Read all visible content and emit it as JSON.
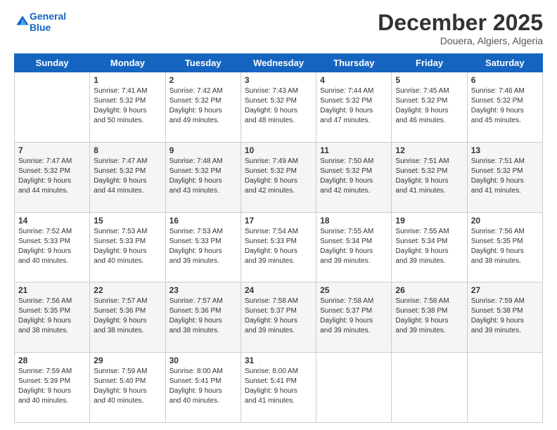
{
  "logo": {
    "line1": "General",
    "line2": "Blue"
  },
  "title": "December 2025",
  "location": "Douera, Algiers, Algeria",
  "days_of_week": [
    "Sunday",
    "Monday",
    "Tuesday",
    "Wednesday",
    "Thursday",
    "Friday",
    "Saturday"
  ],
  "weeks": [
    [
      {
        "num": "",
        "info": ""
      },
      {
        "num": "1",
        "info": "Sunrise: 7:41 AM\nSunset: 5:32 PM\nDaylight: 9 hours\nand 50 minutes."
      },
      {
        "num": "2",
        "info": "Sunrise: 7:42 AM\nSunset: 5:32 PM\nDaylight: 9 hours\nand 49 minutes."
      },
      {
        "num": "3",
        "info": "Sunrise: 7:43 AM\nSunset: 5:32 PM\nDaylight: 9 hours\nand 48 minutes."
      },
      {
        "num": "4",
        "info": "Sunrise: 7:44 AM\nSunset: 5:32 PM\nDaylight: 9 hours\nand 47 minutes."
      },
      {
        "num": "5",
        "info": "Sunrise: 7:45 AM\nSunset: 5:32 PM\nDaylight: 9 hours\nand 46 minutes."
      },
      {
        "num": "6",
        "info": "Sunrise: 7:46 AM\nSunset: 5:32 PM\nDaylight: 9 hours\nand 45 minutes."
      }
    ],
    [
      {
        "num": "7",
        "info": "Sunrise: 7:47 AM\nSunset: 5:32 PM\nDaylight: 9 hours\nand 44 minutes."
      },
      {
        "num": "8",
        "info": "Sunrise: 7:47 AM\nSunset: 5:32 PM\nDaylight: 9 hours\nand 44 minutes."
      },
      {
        "num": "9",
        "info": "Sunrise: 7:48 AM\nSunset: 5:32 PM\nDaylight: 9 hours\nand 43 minutes."
      },
      {
        "num": "10",
        "info": "Sunrise: 7:49 AM\nSunset: 5:32 PM\nDaylight: 9 hours\nand 42 minutes."
      },
      {
        "num": "11",
        "info": "Sunrise: 7:50 AM\nSunset: 5:32 PM\nDaylight: 9 hours\nand 42 minutes."
      },
      {
        "num": "12",
        "info": "Sunrise: 7:51 AM\nSunset: 5:32 PM\nDaylight: 9 hours\nand 41 minutes."
      },
      {
        "num": "13",
        "info": "Sunrise: 7:51 AM\nSunset: 5:32 PM\nDaylight: 9 hours\nand 41 minutes."
      }
    ],
    [
      {
        "num": "14",
        "info": "Sunrise: 7:52 AM\nSunset: 5:33 PM\nDaylight: 9 hours\nand 40 minutes."
      },
      {
        "num": "15",
        "info": "Sunrise: 7:53 AM\nSunset: 5:33 PM\nDaylight: 9 hours\nand 40 minutes."
      },
      {
        "num": "16",
        "info": "Sunrise: 7:53 AM\nSunset: 5:33 PM\nDaylight: 9 hours\nand 39 minutes."
      },
      {
        "num": "17",
        "info": "Sunrise: 7:54 AM\nSunset: 5:33 PM\nDaylight: 9 hours\nand 39 minutes."
      },
      {
        "num": "18",
        "info": "Sunrise: 7:55 AM\nSunset: 5:34 PM\nDaylight: 9 hours\nand 39 minutes."
      },
      {
        "num": "19",
        "info": "Sunrise: 7:55 AM\nSunset: 5:34 PM\nDaylight: 9 hours\nand 39 minutes."
      },
      {
        "num": "20",
        "info": "Sunrise: 7:56 AM\nSunset: 5:35 PM\nDaylight: 9 hours\nand 38 minutes."
      }
    ],
    [
      {
        "num": "21",
        "info": "Sunrise: 7:56 AM\nSunset: 5:35 PM\nDaylight: 9 hours\nand 38 minutes."
      },
      {
        "num": "22",
        "info": "Sunrise: 7:57 AM\nSunset: 5:36 PM\nDaylight: 9 hours\nand 38 minutes."
      },
      {
        "num": "23",
        "info": "Sunrise: 7:57 AM\nSunset: 5:36 PM\nDaylight: 9 hours\nand 38 minutes."
      },
      {
        "num": "24",
        "info": "Sunrise: 7:58 AM\nSunset: 5:37 PM\nDaylight: 9 hours\nand 39 minutes."
      },
      {
        "num": "25",
        "info": "Sunrise: 7:58 AM\nSunset: 5:37 PM\nDaylight: 9 hours\nand 39 minutes."
      },
      {
        "num": "26",
        "info": "Sunrise: 7:58 AM\nSunset: 5:38 PM\nDaylight: 9 hours\nand 39 minutes."
      },
      {
        "num": "27",
        "info": "Sunrise: 7:59 AM\nSunset: 5:38 PM\nDaylight: 9 hours\nand 39 minutes."
      }
    ],
    [
      {
        "num": "28",
        "info": "Sunrise: 7:59 AM\nSunset: 5:39 PM\nDaylight: 9 hours\nand 40 minutes."
      },
      {
        "num": "29",
        "info": "Sunrise: 7:59 AM\nSunset: 5:40 PM\nDaylight: 9 hours\nand 40 minutes."
      },
      {
        "num": "30",
        "info": "Sunrise: 8:00 AM\nSunset: 5:41 PM\nDaylight: 9 hours\nand 40 minutes."
      },
      {
        "num": "31",
        "info": "Sunrise: 8:00 AM\nSunset: 5:41 PM\nDaylight: 9 hours\nand 41 minutes."
      },
      {
        "num": "",
        "info": ""
      },
      {
        "num": "",
        "info": ""
      },
      {
        "num": "",
        "info": ""
      }
    ]
  ]
}
